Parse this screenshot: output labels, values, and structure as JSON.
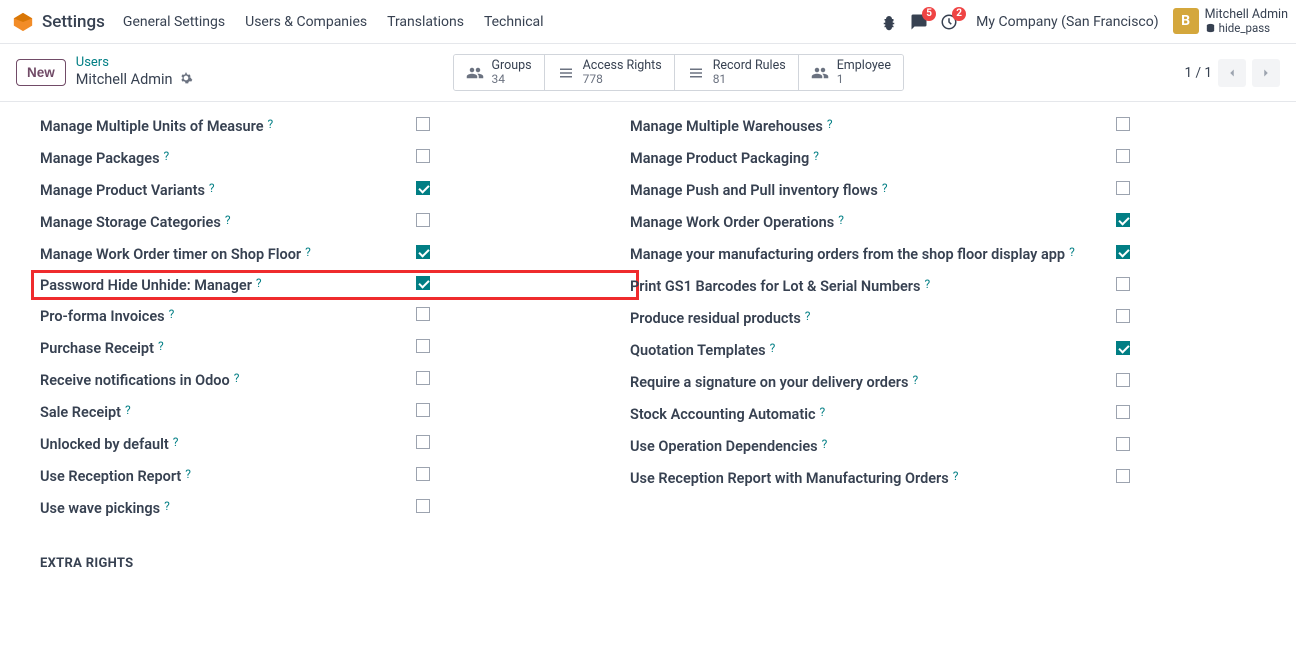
{
  "nav": {
    "app_title": "Settings",
    "links": [
      "General Settings",
      "Users & Companies",
      "Translations",
      "Technical"
    ],
    "messages_badge": "5",
    "activities_badge": "2",
    "company": "My Company (San Francisco)",
    "user_initial": "B",
    "user_name": "Mitchell Admin",
    "user_sub": "hide_pass"
  },
  "toolbar": {
    "new_label": "New",
    "breadcrumb_parent": "Users",
    "breadcrumb_current": "Mitchell Admin",
    "smart": [
      {
        "label": "Groups",
        "count": "34"
      },
      {
        "label": "Access Rights",
        "count": "778"
      },
      {
        "label": "Record Rules",
        "count": "81"
      },
      {
        "label": "Employee",
        "count": "1"
      }
    ],
    "pager_current": "1 / 1"
  },
  "perms": {
    "left": [
      {
        "label": "Manage Multiple Units of Measure",
        "checked": false
      },
      {
        "label": "Manage Packages",
        "checked": false
      },
      {
        "label": "Manage Product Variants",
        "checked": true
      },
      {
        "label": "Manage Storage Categories",
        "checked": false
      },
      {
        "label": "Manage Work Order timer on Shop Floor",
        "checked": true
      },
      {
        "label": "Password Hide Unhide: Manager",
        "checked": true,
        "highlight": true
      },
      {
        "label": "Pro-forma Invoices",
        "checked": false
      },
      {
        "label": "Purchase Receipt",
        "checked": false
      },
      {
        "label": "Receive notifications in Odoo",
        "checked": false
      },
      {
        "label": "Sale Receipt",
        "checked": false
      },
      {
        "label": "Unlocked by default",
        "checked": false
      },
      {
        "label": "Use Reception Report",
        "checked": false
      },
      {
        "label": "Use wave pickings",
        "checked": false
      }
    ],
    "right": [
      {
        "label": "Manage Multiple Warehouses",
        "checked": false
      },
      {
        "label": "Manage Product Packaging",
        "checked": false
      },
      {
        "label": "Manage Push and Pull inventory flows",
        "checked": false
      },
      {
        "label": "Manage Work Order Operations",
        "checked": true
      },
      {
        "label": "Manage your manufacturing orders from the shop floor display app",
        "checked": true
      },
      {
        "label": "Print GS1 Barcodes for Lot & Serial Numbers",
        "checked": false
      },
      {
        "label": "Produce residual products",
        "checked": false
      },
      {
        "label": "Quotation Templates",
        "checked": true
      },
      {
        "label": "Require a signature on your delivery orders",
        "checked": false
      },
      {
        "label": "Stock Accounting Automatic",
        "checked": false
      },
      {
        "label": "Use Operation Dependencies",
        "checked": false
      },
      {
        "label": "Use Reception Report with Manufacturing Orders",
        "checked": false
      }
    ]
  },
  "extra_rights_header": "EXTRA RIGHTS",
  "help_char": "?"
}
